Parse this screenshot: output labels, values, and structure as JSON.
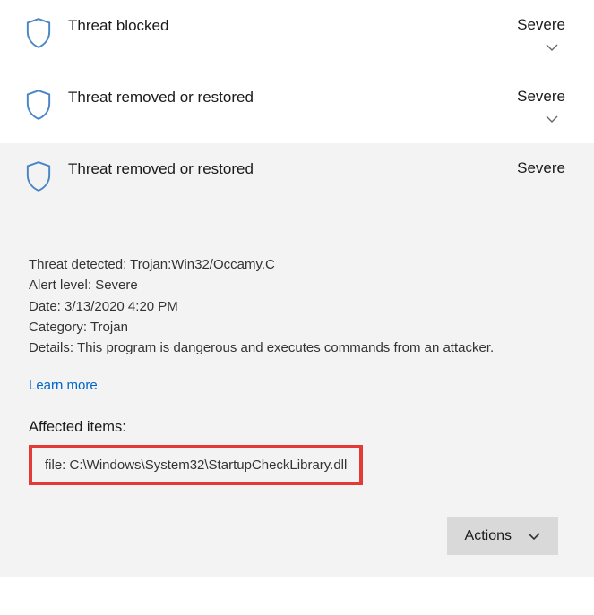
{
  "threats": [
    {
      "title": "Threat blocked",
      "severity": "Severe"
    },
    {
      "title": "Threat removed or restored",
      "severity": "Severe"
    },
    {
      "title": "Threat removed or restored",
      "severity": "Severe"
    }
  ],
  "details": {
    "threat_detected_label": "Threat detected:",
    "threat_detected_value": "Trojan:Win32/Occamy.C",
    "alert_level_label": "Alert level:",
    "alert_level_value": "Severe",
    "date_label": "Date:",
    "date_value": "3/13/2020 4:20 PM",
    "category_label": "Category:",
    "category_value": "Trojan",
    "details_label": "Details:",
    "details_value": "This program is dangerous and executes commands from an attacker."
  },
  "learn_more": "Learn more",
  "affected_items_heading": "Affected items:",
  "affected_file": "file: C:\\Windows\\System32\\StartupCheckLibrary.dll",
  "actions_button": "Actions"
}
